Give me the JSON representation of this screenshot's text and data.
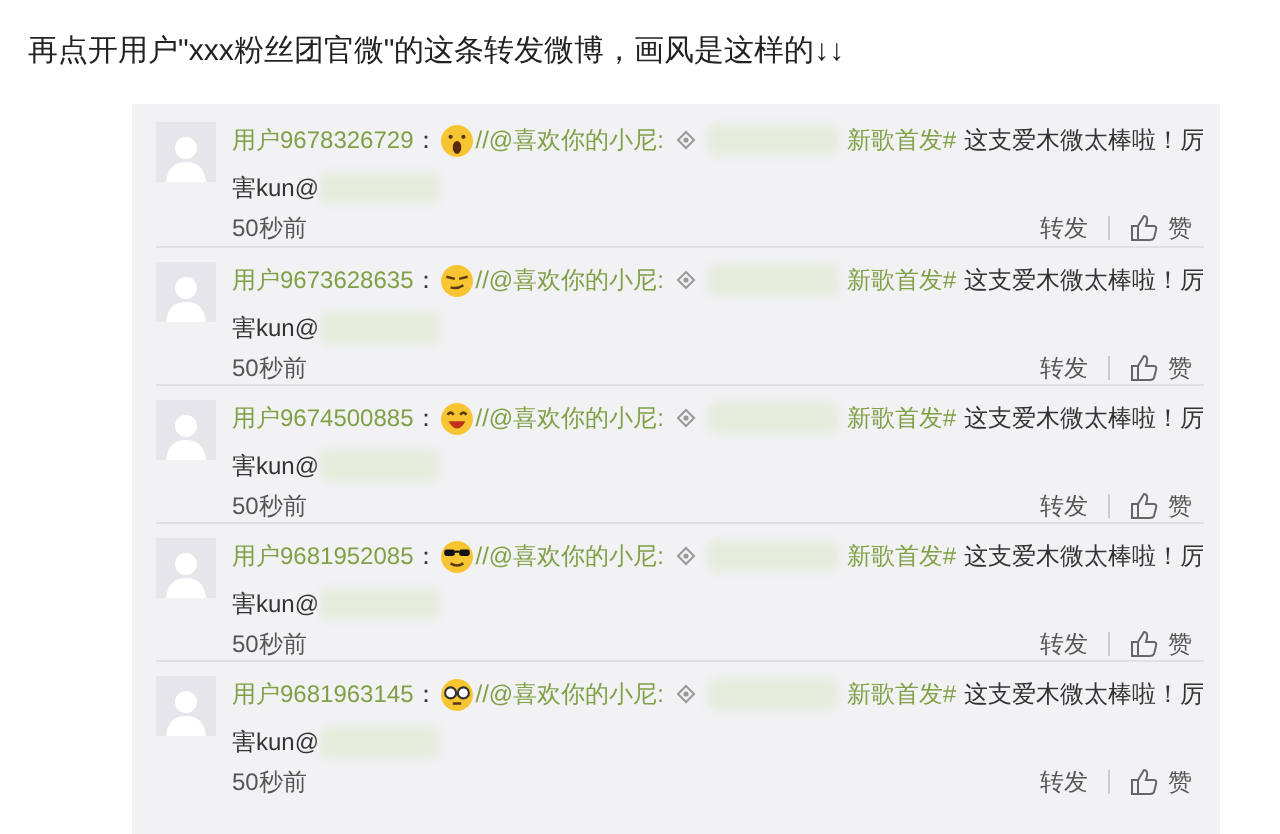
{
  "caption": "再点开用户\"xxx粉丝团官微\"的这条转发微博，画风是这样的↓↓",
  "comments": [
    {
      "user": "用户9678326729",
      "colon": "：",
      "kind": "shock",
      "mention": "//@喜欢你的小尼:",
      "topic": "新歌首发#",
      "text": "这支爱木微太棒啦！厉",
      "text_cont": "害kun@",
      "time": "50秒前",
      "repost": "转发",
      "like": "赞"
    },
    {
      "user": "用户9673628635",
      "colon": "：",
      "kind": "smirk",
      "mention": "//@喜欢你的小尼:",
      "topic": "新歌首发#",
      "text": "这支爱木微太棒啦！厉",
      "text_cont": "害kun@",
      "time": "50秒前",
      "repost": "转发",
      "like": "赞"
    },
    {
      "user": "用户9674500885",
      "colon": "：",
      "kind": "laugh",
      "mention": "//@喜欢你的小尼:",
      "topic": "新歌首发#",
      "text": "这支爱木微太棒啦！厉",
      "text_cont": "害kun@",
      "time": "50秒前",
      "repost": "转发",
      "like": "赞"
    },
    {
      "user": "用户9681952085",
      "colon": "：",
      "kind": "cool",
      "mention": "//@喜欢你的小尼:",
      "topic": "新歌首发#",
      "text": "这支爱木微太棒啦！厉",
      "text_cont": "害kun@",
      "time": "50秒前",
      "repost": "转发",
      "like": "赞"
    },
    {
      "user": "用户9681963145",
      "colon": "：",
      "kind": "glasses",
      "mention": "//@喜欢你的小尼:",
      "topic": "新歌首发#",
      "text": "这支爱木微太棒啦！厉",
      "text_cont": "害kun@",
      "time": "50秒前",
      "repost": "转发",
      "like": "赞"
    }
  ]
}
